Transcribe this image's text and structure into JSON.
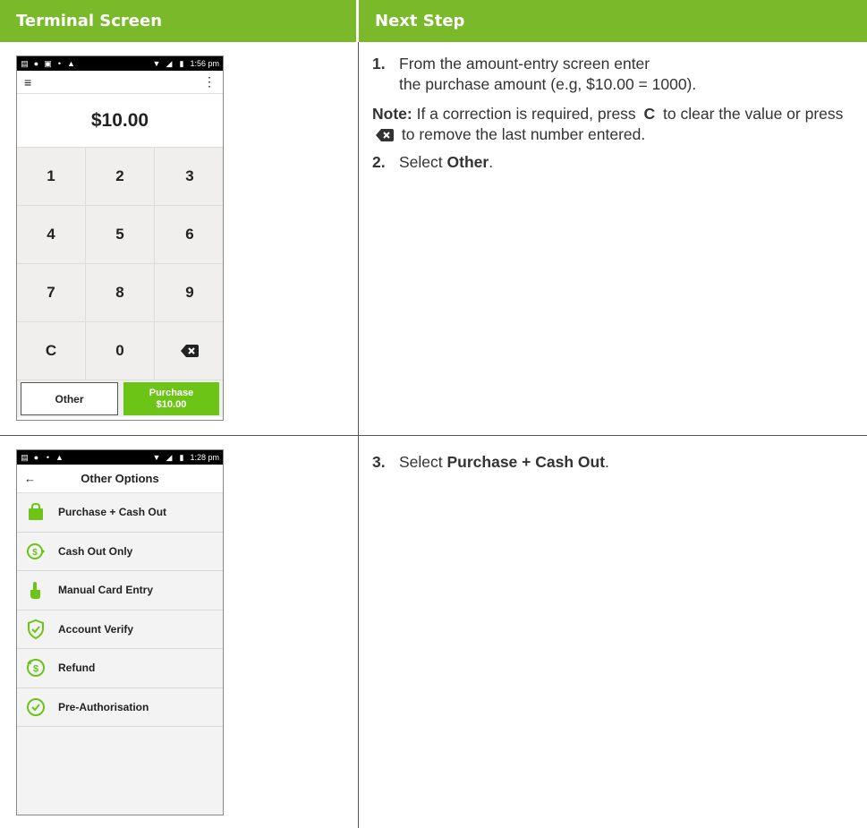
{
  "header": {
    "left": "Terminal Screen",
    "right": "Next Step"
  },
  "screen1": {
    "time": "1:56 pm",
    "amount": "$10.00",
    "keys": [
      "1",
      "2",
      "3",
      "4",
      "5",
      "6",
      "7",
      "8",
      "9",
      "C",
      "0"
    ],
    "delete_icon": "backspace-icon",
    "other_label": "Other",
    "purchase_label": "Purchase",
    "purchase_amount": "$10.00",
    "accent_color": "#6cc417"
  },
  "screen2": {
    "time": "1:28 pm",
    "title": "Other Options",
    "options": [
      {
        "label": "Purchase + Cash Out",
        "icon": "shopping-bag-icon"
      },
      {
        "label": "Cash Out Only",
        "icon": "cash-out-icon"
      },
      {
        "label": "Manual Card Entry",
        "icon": "hand-tap-icon"
      },
      {
        "label": "Account Verify",
        "icon": "shield-check-icon"
      },
      {
        "label": "Refund",
        "icon": "refund-icon"
      },
      {
        "label": "Pre-Authorisation",
        "icon": "clock-check-icon"
      }
    ]
  },
  "steps": {
    "s1_num": "1.",
    "s1_line1": "From the amount-entry screen enter",
    "s1_line2": "the purchase amount (e.g, $10.00 = 1000).",
    "note_label": "Note:",
    "note_part1": " If a correction is required, press ",
    "note_c": "C",
    "note_part2": " to clear the value or press ",
    "note_part3": " to remove the last number entered.",
    "s2_num": "2.",
    "s2_prefix": "Select ",
    "s2_bold": "Other",
    "s2_suffix": ".",
    "s3_num": "3.",
    "s3_prefix": "Select ",
    "s3_bold": "Purchase + Cash Out",
    "s3_suffix": "."
  },
  "colors": {
    "header_bg": "#7ab929",
    "accent": "#6cc417"
  }
}
